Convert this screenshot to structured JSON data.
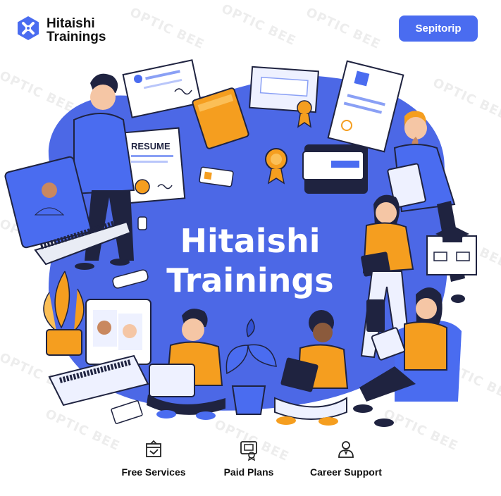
{
  "brand": {
    "name_line1": "Hitaishi",
    "name_line2": "Trainings",
    "logo_icon": "hexagon-x-logo"
  },
  "header": {
    "cta_label": "Sepitorip"
  },
  "hero": {
    "headline_line1": "Hitaishi",
    "headline_line2": "Trainings",
    "resume_label": "RESUME",
    "illustration": "people-training-illustration"
  },
  "watermark": {
    "text": "OPTIC BEE"
  },
  "features": [
    {
      "label": "Free Services",
      "icon": "gift-box-icon"
    },
    {
      "label": "Paid Plans",
      "icon": "certificate-icon"
    },
    {
      "label": "Career Support",
      "icon": "user-support-icon"
    }
  ],
  "colors": {
    "accent": "#4a6cf0",
    "blob": "#4c68e6",
    "orange": "#f59e1f",
    "navy": "#1f2340"
  }
}
